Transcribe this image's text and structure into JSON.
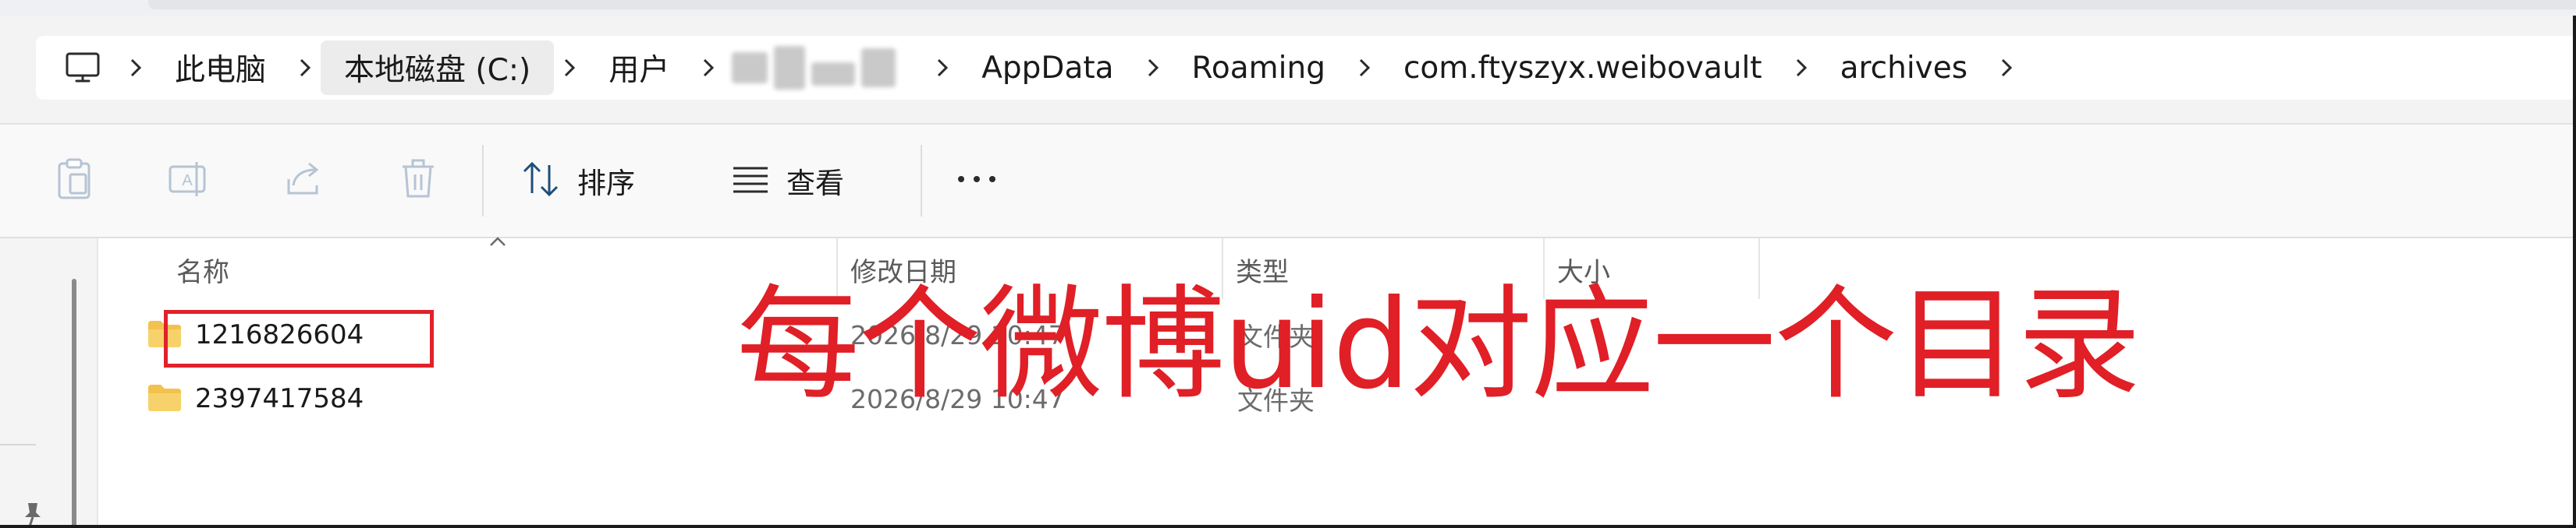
{
  "breadcrumb": {
    "items": [
      {
        "label": "此电脑",
        "active": false
      },
      {
        "label": "本地磁盘 (C:)",
        "active": true
      },
      {
        "label": "用户",
        "active": false
      },
      {
        "label": "",
        "redacted": true
      },
      {
        "label": "AppData",
        "active": false
      },
      {
        "label": "Roaming",
        "active": false
      },
      {
        "label": "com.ftyszyx.weibovault",
        "active": false
      },
      {
        "label": "archives",
        "active": false
      }
    ]
  },
  "toolbar": {
    "sort_label": "排序",
    "view_label": "查看",
    "more_label": "···"
  },
  "columns": {
    "name": "名称",
    "modified": "修改日期",
    "type": "类型",
    "size": "大小"
  },
  "files": [
    {
      "name": "1216826604",
      "modified": "2026/8/29 10:47",
      "type": "文件夹"
    },
    {
      "name": "2397417584",
      "modified": "2026/8/29 10:47",
      "type": "文件夹"
    }
  ],
  "annotation": {
    "text": "每个微博uid对应一个目录",
    "color": "#e01f26"
  },
  "colors": {
    "folder": "#f2c14e",
    "accent": "#0067c0",
    "annotation_red": "#e0222a"
  }
}
